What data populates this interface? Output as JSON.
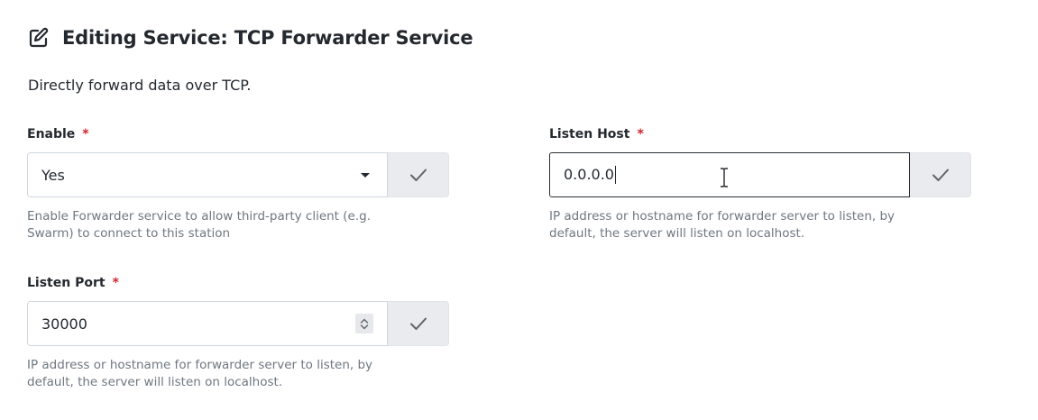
{
  "header": {
    "icon": "edit-icon",
    "title": "Editing Service: TCP Forwarder Service"
  },
  "description": "Directly forward data over TCP.",
  "required_marker": "*",
  "fields": {
    "enable": {
      "label": "Enable",
      "value": "Yes",
      "help": "Enable Forwarder service to allow third-party client (e.g. Swarm) to connect to this station"
    },
    "listen_host": {
      "label": "Listen Host",
      "value": "0.0.0.0",
      "help": "IP address or hostname for forwarder server to listen, by default, the server will listen on localhost."
    },
    "listen_port": {
      "label": "Listen Port",
      "value": "30000",
      "help": "IP address or hostname for forwarder server to listen, by default, the server will listen on localhost."
    }
  },
  "colors": {
    "required": "#d1242f",
    "apply_button_bg": "#e9ebee",
    "help_text": "#6e7781"
  }
}
